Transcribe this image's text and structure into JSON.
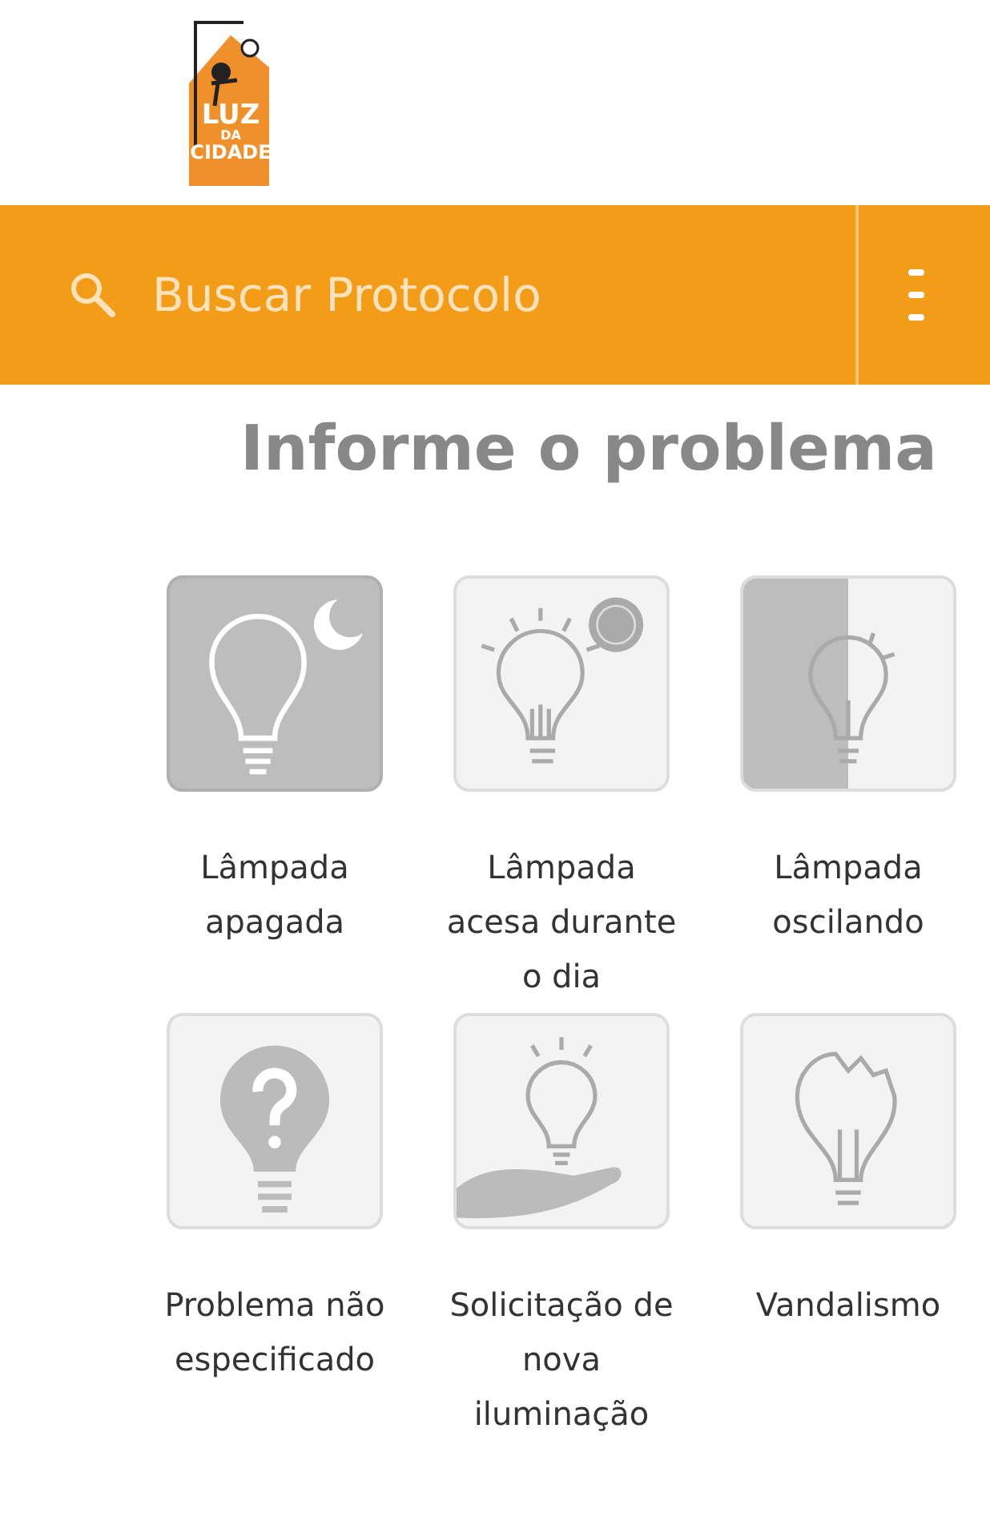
{
  "logo": {
    "line_1": "LUZ",
    "line_2": "DA",
    "line_3": "CIDADE"
  },
  "search": {
    "placeholder": "Buscar Protocolo"
  },
  "title": "Informe o problema",
  "problems": [
    {
      "label": "Lâmpada apagada",
      "kind": "night"
    },
    {
      "label": "Lâmpada acesa durante o dia",
      "kind": "day"
    },
    {
      "label": "Lâmpada oscilando",
      "kind": "flicker"
    },
    {
      "label": "Problema não especificado",
      "kind": "question"
    },
    {
      "label": "Solicitação de nova iluminação",
      "kind": "request"
    },
    {
      "label": "Vandalismo",
      "kind": "broken"
    }
  ]
}
